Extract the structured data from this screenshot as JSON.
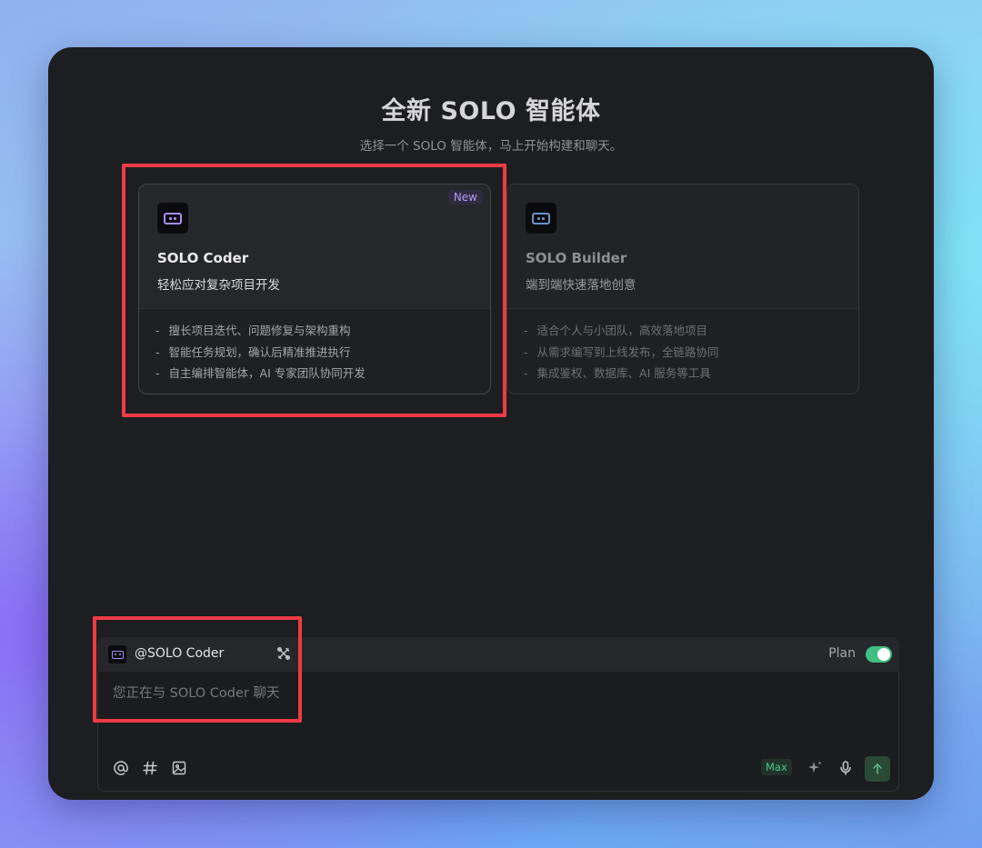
{
  "header": {
    "title": "全新 SOLO 智能体",
    "subtitle": "选择一个 SOLO 智能体，马上开始构建和聊天。"
  },
  "cards": [
    {
      "name": "SOLO Coder",
      "desc": "轻松应对复杂项目开发",
      "badge": "New",
      "icon": "robot-face-icon",
      "features": [
        "擅长项目迭代、问题修复与架构重构",
        "智能任务规划，确认后精准推进执行",
        "自主编排智能体，AI 专家团队协同开发"
      ]
    },
    {
      "name": "SOLO Builder",
      "desc": "端到端快速落地创意",
      "icon": "robot-face-icon",
      "features": [
        "适合个人与小团队，高效落地项目",
        "从需求编写到上线发布，全链路协同",
        "集成鉴权、数据库、AI 服务等工具"
      ]
    }
  ],
  "composer": {
    "mention": "@SOLO Coder",
    "plan_label": "Plan",
    "plan_enabled": true,
    "placeholder": "您正在与 SOLO Coder 聊天",
    "value": "",
    "max_label": "Max",
    "toolbar_icons": [
      "at-icon",
      "hash-icon",
      "image-icon",
      "sparkle-icon",
      "microphone-icon",
      "send-arrow-icon"
    ]
  },
  "colors": {
    "highlight": "#ee3b45",
    "accent_purple": "#a98cf7",
    "toggle_on": "#3fbf84",
    "window_bg": "#1d1e21"
  }
}
